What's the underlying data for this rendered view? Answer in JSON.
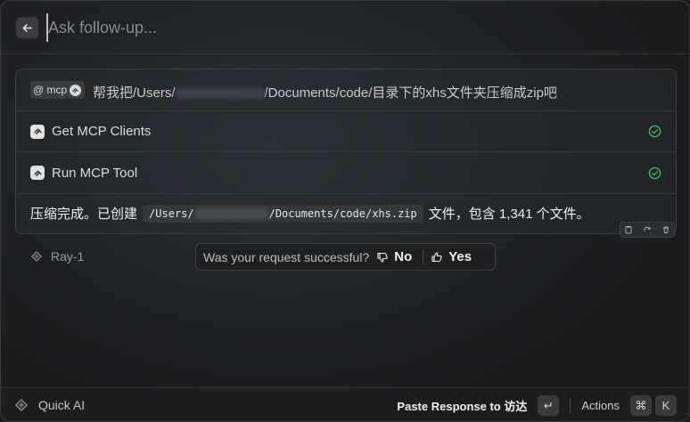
{
  "header": {
    "back_icon": "arrow-left-icon",
    "input_value": "",
    "input_placeholder": "Ask follow-up..."
  },
  "conversation": {
    "prompt": {
      "badge_label": "@ mcp",
      "text_before": "帮我把/Users/",
      "text_after": "/Documents/code/目录下的xhs文件夹压缩成zip吧"
    },
    "tool_calls": [
      {
        "label": "Get MCP Clients",
        "status_icon": "check-circle-icon"
      },
      {
        "label": "Run MCP Tool",
        "status_icon": "check-circle-icon"
      }
    ],
    "answer": {
      "text_before": "压缩完成。已创建",
      "code_before": "/Users/",
      "code_after": "/Documents/code/xhs.zip",
      "text_after": "文件，包含 1,341 个文件。"
    }
  },
  "model": {
    "name": "Ray-1",
    "icon": "ray-icon"
  },
  "feedback": {
    "question": "Was your request successful?",
    "no_label": "No",
    "yes_label": "Yes"
  },
  "footer": {
    "app_name": "Quick AI",
    "paste_label": "Paste Response to 访达",
    "paste_key": "↵",
    "actions_label": "Actions",
    "actions_keys": [
      "⌘",
      "K"
    ]
  },
  "colors": {
    "success": "#3fb96a",
    "background": "#1b1b1d",
    "accent_text": "#f2f2f2"
  }
}
